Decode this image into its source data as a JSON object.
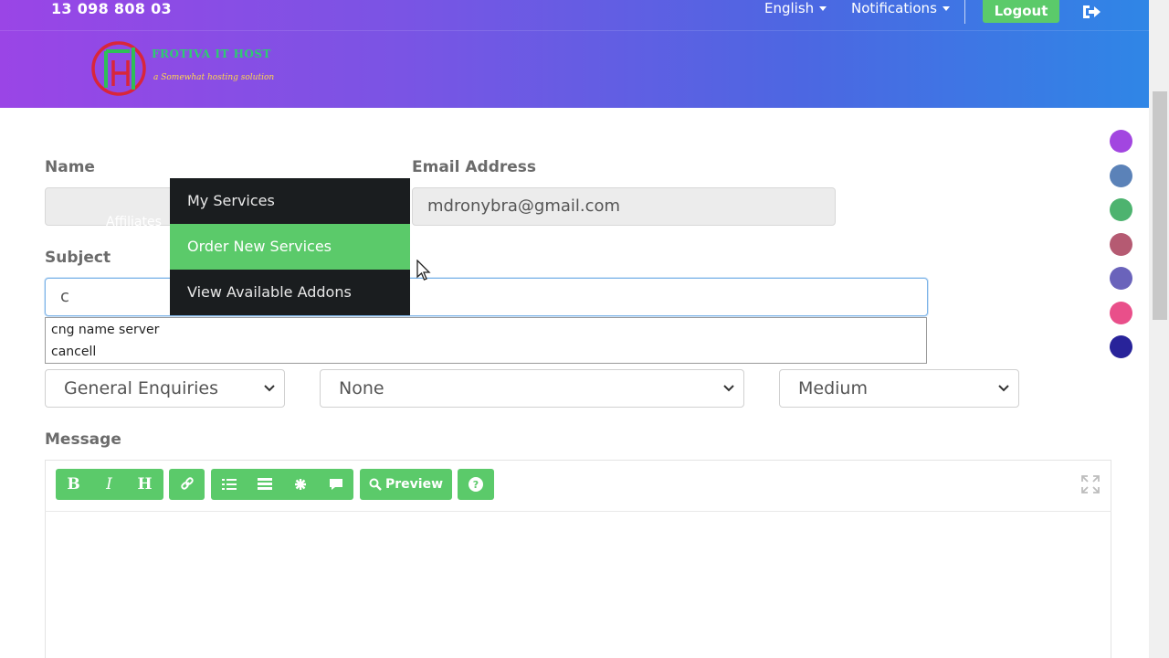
{
  "topbar": {
    "phone": "13 098 808 03",
    "language": "English",
    "notifications": "Notifications",
    "logout": "Logout"
  },
  "brand": {
    "name": "FROTIVA IT HOST",
    "tagline": "a Somewhat hosting solution",
    "colors": {
      "gradient_start": "#9a45e6",
      "gradient_end": "#2f86e6",
      "accent": "#5bca6a"
    }
  },
  "form": {
    "name_label": "Name",
    "name_value": "",
    "email_label": "Email Address",
    "email_value": "mdronybra@gmail.com",
    "subject_label": "Subject",
    "subject_value": "c",
    "autocomplete": [
      "cng name server",
      "cancell"
    ],
    "department": "General Enquiries",
    "related_service": "None",
    "priority": "Medium",
    "message_label": "Message"
  },
  "editor_toolbar": {
    "bold": "B",
    "italic": "I",
    "heading": "H",
    "preview": "Preview"
  },
  "dropdown_menu": {
    "items": [
      "My Services",
      "Order New Services",
      "View Available Addons"
    ],
    "active_index": 1,
    "hidden_behind": "Affiliates"
  },
  "color_dots": [
    "#a246e0",
    "#5b82b8",
    "#4db36f",
    "#b55a72",
    "#6a63bb",
    "#e94f8a",
    "#28239a"
  ]
}
